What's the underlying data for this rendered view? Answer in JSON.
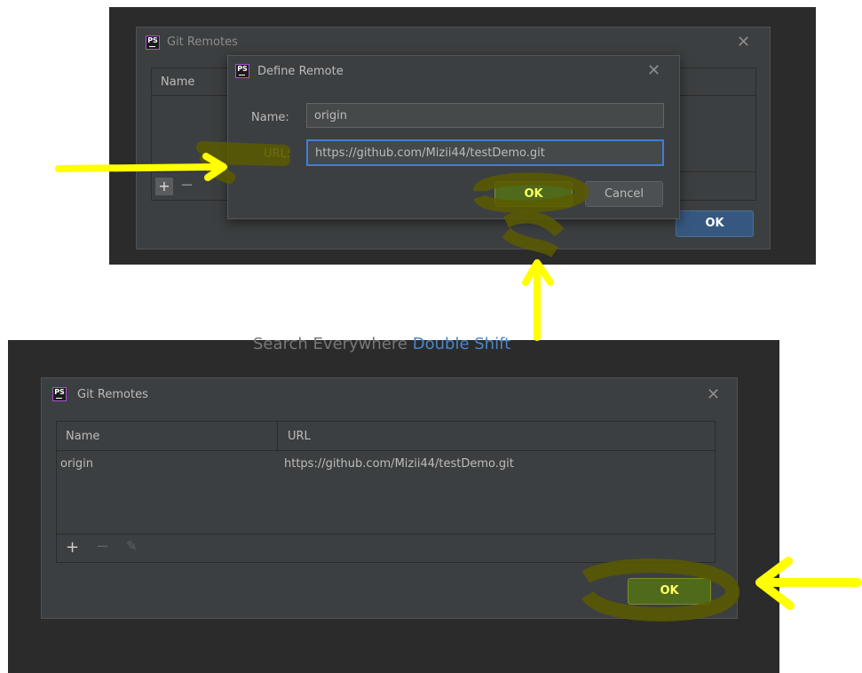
{
  "top_panel": {
    "git_remotes_title": "Git Remotes",
    "table_header_name": "Name",
    "ok_label": "OK",
    "define_remote": {
      "title": "Define Remote",
      "name_label": "Name:",
      "name_value": "origin",
      "url_label": "URL:",
      "url_value": "https://github.com/Mizii44/testDemo.git",
      "ok_label": "OK",
      "cancel_label": "Cancel"
    }
  },
  "bottom_panel": {
    "search_hint": "Search Everywhere",
    "search_shortcut": "Double Shift",
    "git_remotes_title": "Git Remotes",
    "columns": [
      "Name",
      "URL"
    ],
    "rows": [
      {
        "name": "origin",
        "url": "https://github.com/Mizii44/testDemo.git"
      }
    ],
    "ok_label": "OK"
  },
  "logo_text": "PS",
  "icons": {
    "close": "close-icon",
    "add": "plus-icon",
    "remove": "minus-icon",
    "edit": "pencil-icon",
    "app_logo": "phpstorm-logo-icon"
  },
  "colors": {
    "ide_background": "#2b2b2b",
    "dialog_background": "#3c3f41",
    "field_background": "#45494a",
    "focus_blue": "#3d7fd6",
    "primary_button": "#365880",
    "annotation_yellow": "#ffff00",
    "annotation_olive": "#5a5a00"
  }
}
